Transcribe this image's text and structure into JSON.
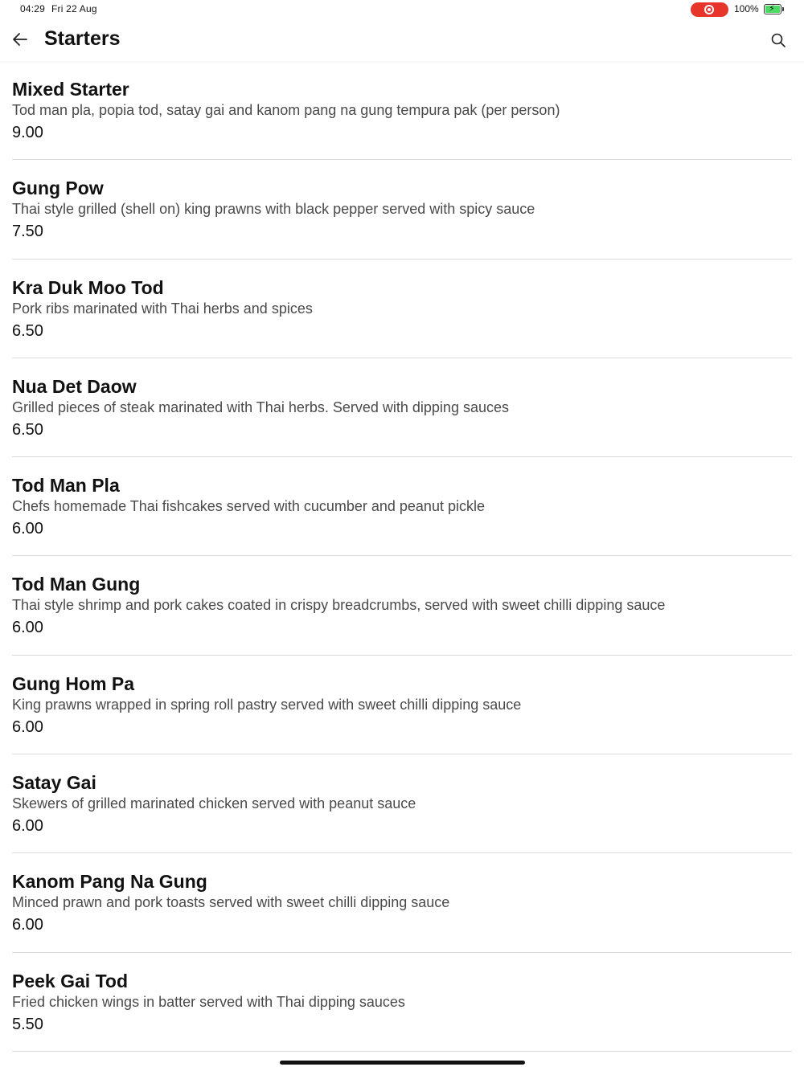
{
  "status_bar": {
    "time": "04:29",
    "date": "Fri 22 Aug",
    "battery": "100%",
    "record_color": "#e8352b",
    "battery_color": "#4cd964"
  },
  "header": {
    "title": "Starters",
    "back_icon": "arrow-left-icon",
    "search_icon": "search-icon"
  },
  "items": [
    {
      "name": "Mixed Starter",
      "description": "Tod man pla, popia tod, satay gai and kanom pang na gung tempura pak (per person)",
      "price": "9.00"
    },
    {
      "name": "Gung Pow",
      "description": "Thai style grilled (shell on) king prawns with black pepper served with spicy sauce",
      "price": "7.50"
    },
    {
      "name": "Kra Duk Moo Tod",
      "description": "Pork ribs marinated with Thai herbs and spices",
      "price": "6.50"
    },
    {
      "name": "Nua Det Daow",
      "description": "Grilled pieces of steak marinated with Thai herbs. Served with dipping sauces",
      "price": "6.50"
    },
    {
      "name": "Tod Man Pla",
      "description": "Chefs homemade Thai fishcakes served with cucumber and peanut pickle",
      "price": "6.00"
    },
    {
      "name": "Tod Man Gung",
      "description": "Thai style shrimp and pork cakes coated in crispy breadcrumbs, served with sweet chilli dipping sauce",
      "price": "6.00"
    },
    {
      "name": "Gung Hom Pa",
      "description": "King prawns wrapped in spring roll pastry served with sweet chilli dipping sauce",
      "price": "6.00"
    },
    {
      "name": "Satay Gai",
      "description": "Skewers of grilled marinated chicken served with peanut sauce",
      "price": "6.00"
    },
    {
      "name": "Kanom Pang Na Gung",
      "description": "Minced prawn and pork toasts served with sweet chilli dipping sauce",
      "price": "6.00"
    },
    {
      "name": "Peek Gai Tod",
      "description": "Fried chicken wings in batter served with Thai dipping sauces",
      "price": "5.50"
    }
  ]
}
